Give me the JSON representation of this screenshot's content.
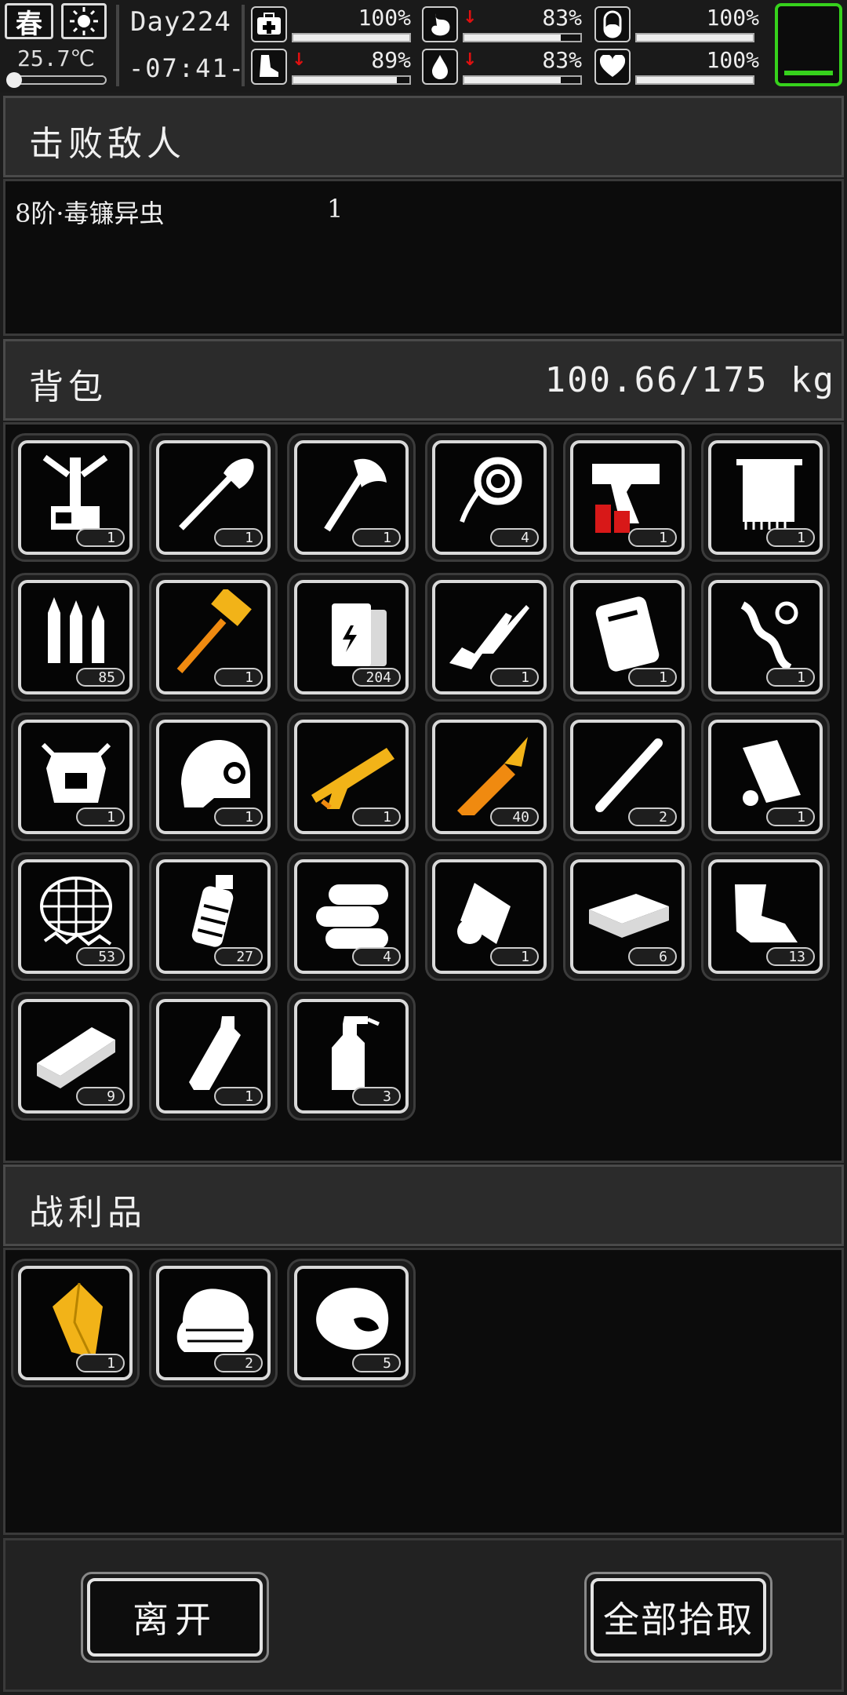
{
  "status": {
    "season": "春",
    "weather_icon": "sun-icon",
    "temperature": "25.7℃",
    "day": "Day224",
    "time": "-07:41-",
    "stats": [
      {
        "icon": "medkit-icon",
        "percent": "100%",
        "value": 1.0,
        "down": false
      },
      {
        "icon": "stomach-icon",
        "percent": "83%",
        "value": 0.83,
        "down": true
      },
      {
        "icon": "pill-icon",
        "percent": "100%",
        "value": 1.0,
        "down": false
      },
      {
        "icon": "foot-icon",
        "percent": "89%",
        "value": 0.89,
        "down": true
      },
      {
        "icon": "water-drop-icon",
        "percent": "83%",
        "value": 0.83,
        "down": true
      },
      {
        "icon": "heart-icon",
        "percent": "100%",
        "value": 1.0,
        "down": false
      }
    ]
  },
  "defeated": {
    "title": "击败敌人",
    "enemy_name": "8阶·毒镰异虫",
    "enemy_count": "1"
  },
  "backpack": {
    "title": "背包",
    "weight": "100.66/175 kg",
    "items": [
      {
        "name": "weapon-rack",
        "count": "1"
      },
      {
        "name": "shovel",
        "count": "1"
      },
      {
        "name": "axe",
        "count": "1"
      },
      {
        "name": "rope",
        "count": "4"
      },
      {
        "name": "flare-gun",
        "count": "1"
      },
      {
        "name": "towel",
        "count": "1"
      },
      {
        "name": "bullets",
        "count": "85"
      },
      {
        "name": "golden-hammer",
        "count": "1"
      },
      {
        "name": "battery",
        "count": "204"
      },
      {
        "name": "rifle",
        "count": "1"
      },
      {
        "name": "armor-plate",
        "count": "1"
      },
      {
        "name": "tentacle-parts",
        "count": "1"
      },
      {
        "name": "mech-armor",
        "count": "1"
      },
      {
        "name": "helmet",
        "count": "1"
      },
      {
        "name": "golden-shotgun",
        "count": "1"
      },
      {
        "name": "rocket-ammo",
        "count": "40"
      },
      {
        "name": "stick",
        "count": "2"
      },
      {
        "name": "paper-scroll",
        "count": "1"
      },
      {
        "name": "net",
        "count": "53"
      },
      {
        "name": "grenade",
        "count": "27"
      },
      {
        "name": "logs",
        "count": "4"
      },
      {
        "name": "cloth-roll",
        "count": "1"
      },
      {
        "name": "money-brick",
        "count": "6"
      },
      {
        "name": "bone-scrap",
        "count": "13"
      },
      {
        "name": "metal-ingot",
        "count": "9"
      },
      {
        "name": "bottle",
        "count": "1"
      },
      {
        "name": "spray-bottle",
        "count": "3"
      }
    ]
  },
  "loot": {
    "title": "战利品",
    "items": [
      {
        "name": "gold-crystal",
        "count": "1"
      },
      {
        "name": "folded-cloth",
        "count": "2"
      },
      {
        "name": "raw-meat",
        "count": "5"
      }
    ]
  },
  "buttons": {
    "leave": "离开",
    "take_all": "全部拾取"
  },
  "colors": {
    "accent_green": "#36d21c",
    "down_arrow": "#e01010",
    "gold_item": "#f2b318"
  }
}
